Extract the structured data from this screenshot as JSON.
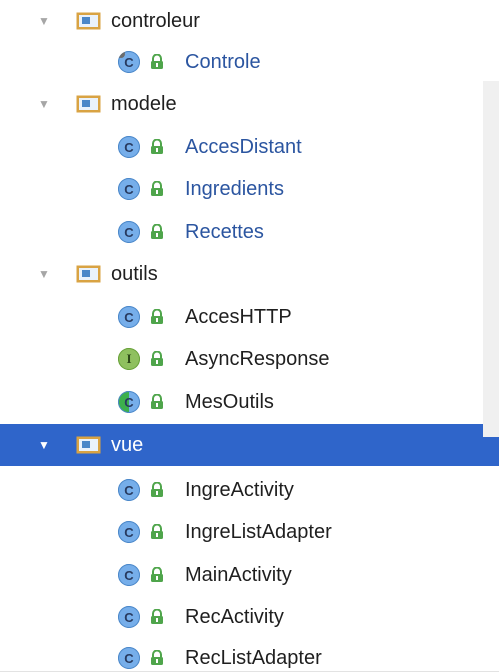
{
  "tree": {
    "packages": [
      {
        "name": "controleur",
        "expanded": true,
        "selected": false,
        "classes": [
          {
            "name": "Controle",
            "kind": "class",
            "color": "#2b55a0"
          }
        ]
      },
      {
        "name": "modele",
        "expanded": true,
        "selected": false,
        "classes": [
          {
            "name": "AccesDistant",
            "kind": "class",
            "color": "#2b55a0"
          },
          {
            "name": "Ingredients",
            "kind": "class",
            "color": "#2b55a0"
          },
          {
            "name": "Recettes",
            "kind": "class",
            "color": "#2b55a0"
          }
        ]
      },
      {
        "name": "outils",
        "expanded": true,
        "selected": false,
        "classes": [
          {
            "name": "AccesHTTP",
            "kind": "class",
            "color": "#1f1f1f"
          },
          {
            "name": "AsyncResponse",
            "kind": "interface",
            "color": "#1f1f1f"
          },
          {
            "name": "MesOutils",
            "kind": "class",
            "color": "#1f1f1f"
          }
        ]
      },
      {
        "name": "vue",
        "expanded": true,
        "selected": true,
        "classes": [
          {
            "name": "IngreActivity",
            "kind": "class",
            "color": "#1f1f1f"
          },
          {
            "name": "IngreListAdapter",
            "kind": "class",
            "color": "#1f1f1f"
          },
          {
            "name": "MainActivity",
            "kind": "class",
            "color": "#1f1f1f"
          },
          {
            "name": "RecActivity",
            "kind": "class",
            "color": "#1f1f1f"
          },
          {
            "name": "RecListAdapter",
            "kind": "class",
            "color": "#1f1f1f"
          }
        ]
      }
    ]
  },
  "icons": {
    "expand": "triangle-down-icon",
    "package": "package-folder-icon",
    "class": "class-c-icon",
    "interface": "interface-i-icon",
    "lock": "lock-icon"
  },
  "glyphs": {
    "class_letter": "C",
    "interface_letter": "I"
  },
  "colors": {
    "selection": "#2f65ca",
    "folder_orange": "#d9a343",
    "class_blue": "#76aeea",
    "interface_green": "#8fc05f",
    "lock_green": "#4fa54b",
    "text_blue": "#2b55a0"
  }
}
